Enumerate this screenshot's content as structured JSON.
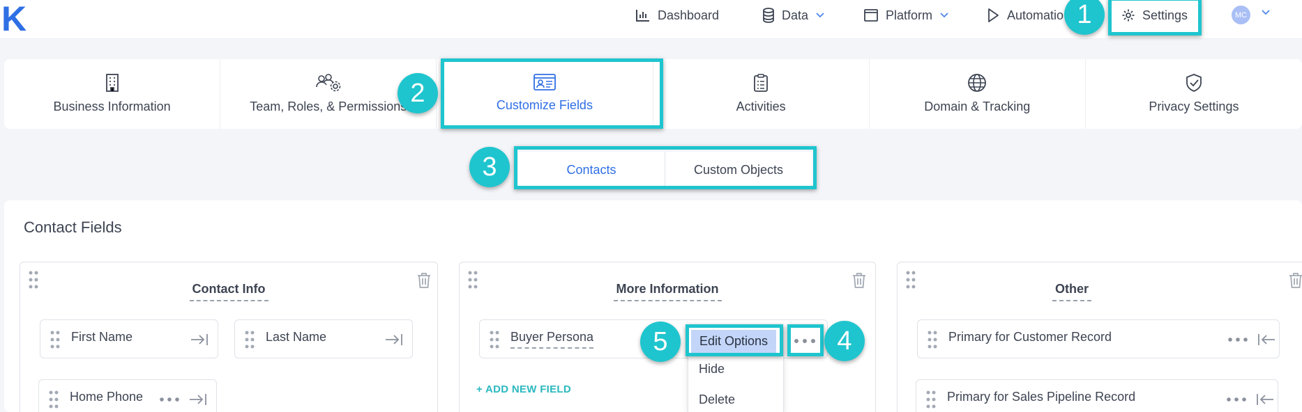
{
  "app": {
    "logo": "K"
  },
  "topnav": {
    "dashboard": "Dashboard",
    "data": "Data",
    "platform": "Platform",
    "automation": "Automatio",
    "settings": "Settings",
    "avatar": "MC"
  },
  "tabs": [
    {
      "label": "Business Information",
      "icon": "building-icon"
    },
    {
      "label": "Team, Roles, & Permissions",
      "icon": "team-settings-icon"
    },
    {
      "label": "Customize Fields",
      "icon": "id-card-icon"
    },
    {
      "label": "Activities",
      "icon": "clipboard-icon"
    },
    {
      "label": "Domain & Tracking",
      "icon": "globe-icon"
    },
    {
      "label": "Privacy Settings",
      "icon": "shield-check-icon"
    }
  ],
  "subtabs": {
    "contacts": "Contacts",
    "custom_objects": "Custom Objects"
  },
  "panel": {
    "title": "Contact Fields",
    "sections": [
      {
        "title": "Contact Info",
        "fields": [
          "First Name",
          "Last Name",
          "Home Phone"
        ]
      },
      {
        "title": "More Information",
        "fields": [
          "Buyer Persona"
        ],
        "add_label": "+ ADD NEW FIELD"
      },
      {
        "title": "Other",
        "fields": [
          "Primary for Customer Record",
          "Primary for Sales Pipeline Record"
        ]
      }
    ]
  },
  "menu": {
    "edit": "Edit Options",
    "hide": "Hide",
    "delete": "Delete"
  },
  "badges": [
    "1",
    "2",
    "3",
    "4",
    "5"
  ],
  "colors": {
    "accent": "#2f6fe4",
    "highlight": "#1fc5ce",
    "menu_selected": "#c3d6f9"
  }
}
